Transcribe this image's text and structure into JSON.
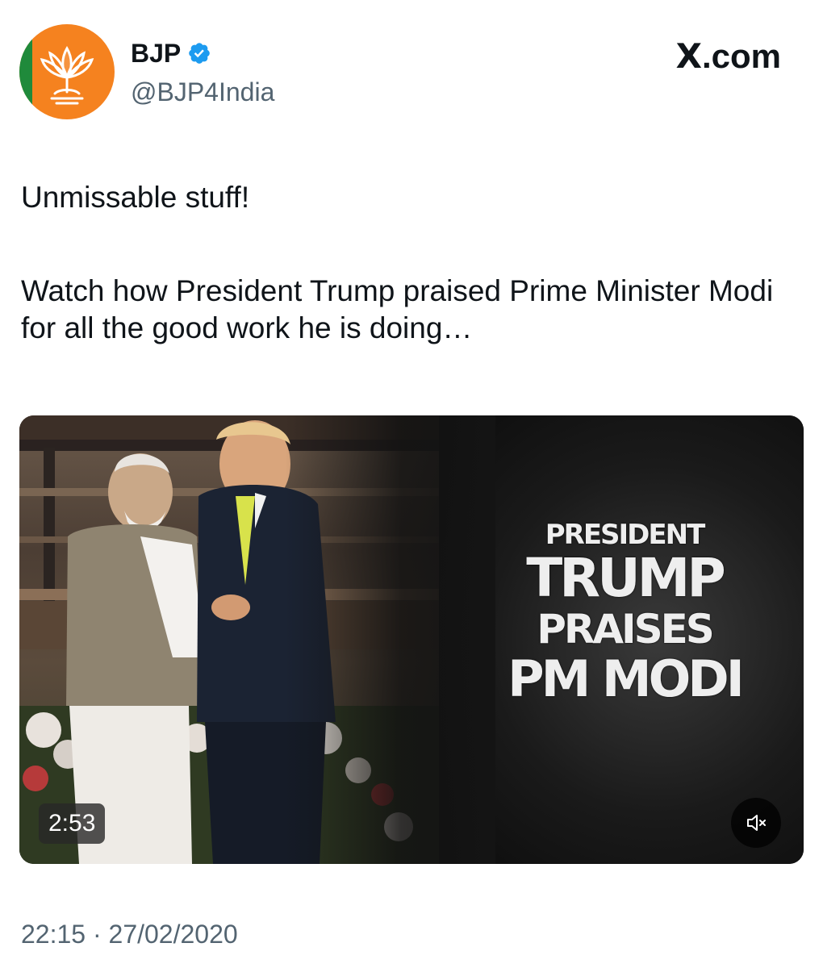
{
  "author": {
    "name": "BJP",
    "handle": "@BJP4India",
    "verified": true,
    "avatar_icon": "bjp-lotus-logo"
  },
  "brand": {
    "label": "X.com"
  },
  "post": {
    "text_line1": "Unmissable stuff!",
    "text_line2": "Watch how President Trump praised Prime Minister Modi for all the good work he is doing…"
  },
  "media": {
    "headline_line1": "PRESIDENT",
    "headline_line2": "TRUMP",
    "headline_line3": "PRAISES",
    "headline_line4": "PM MODI",
    "duration": "2:53",
    "mute_icon": "speaker-muted-icon"
  },
  "timestamp": "22:15 · 27/02/2020",
  "colors": {
    "verified_badge": "#1d9bf0",
    "secondary_text": "#536471",
    "avatar_bg": "#f5821f"
  }
}
